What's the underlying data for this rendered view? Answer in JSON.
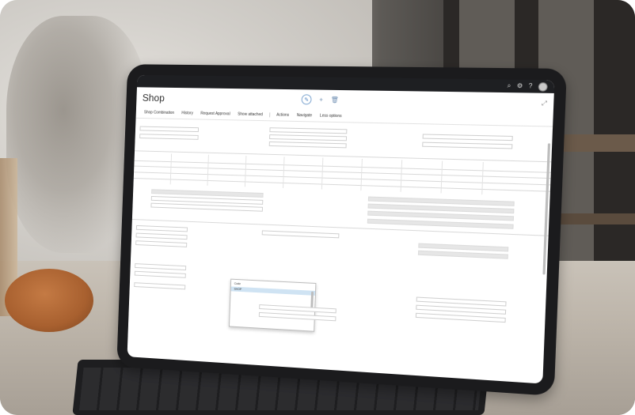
{
  "app": {
    "title": "Shop"
  },
  "actions": {
    "items": [
      {
        "label": "Shop Combination"
      },
      {
        "label": "History"
      },
      {
        "label": "Request Approval"
      },
      {
        "label": "Show attached"
      },
      {
        "label": "Actions"
      },
      {
        "label": "Navigate"
      },
      {
        "label": "Less options"
      }
    ]
  },
  "colors": {
    "topbar": "#1e1f22",
    "accent": "#4a7fbf",
    "selected_row": "#cfe3f3"
  },
  "icons": {
    "topbar": [
      "search-icon",
      "settings-icon",
      "help-icon",
      "avatar"
    ],
    "title": [
      "edit-icon",
      "add-icon",
      "delete-icon"
    ]
  },
  "dropdown": {
    "rows": [
      {
        "type": "Code",
        "name": "SHOP"
      }
    ]
  }
}
